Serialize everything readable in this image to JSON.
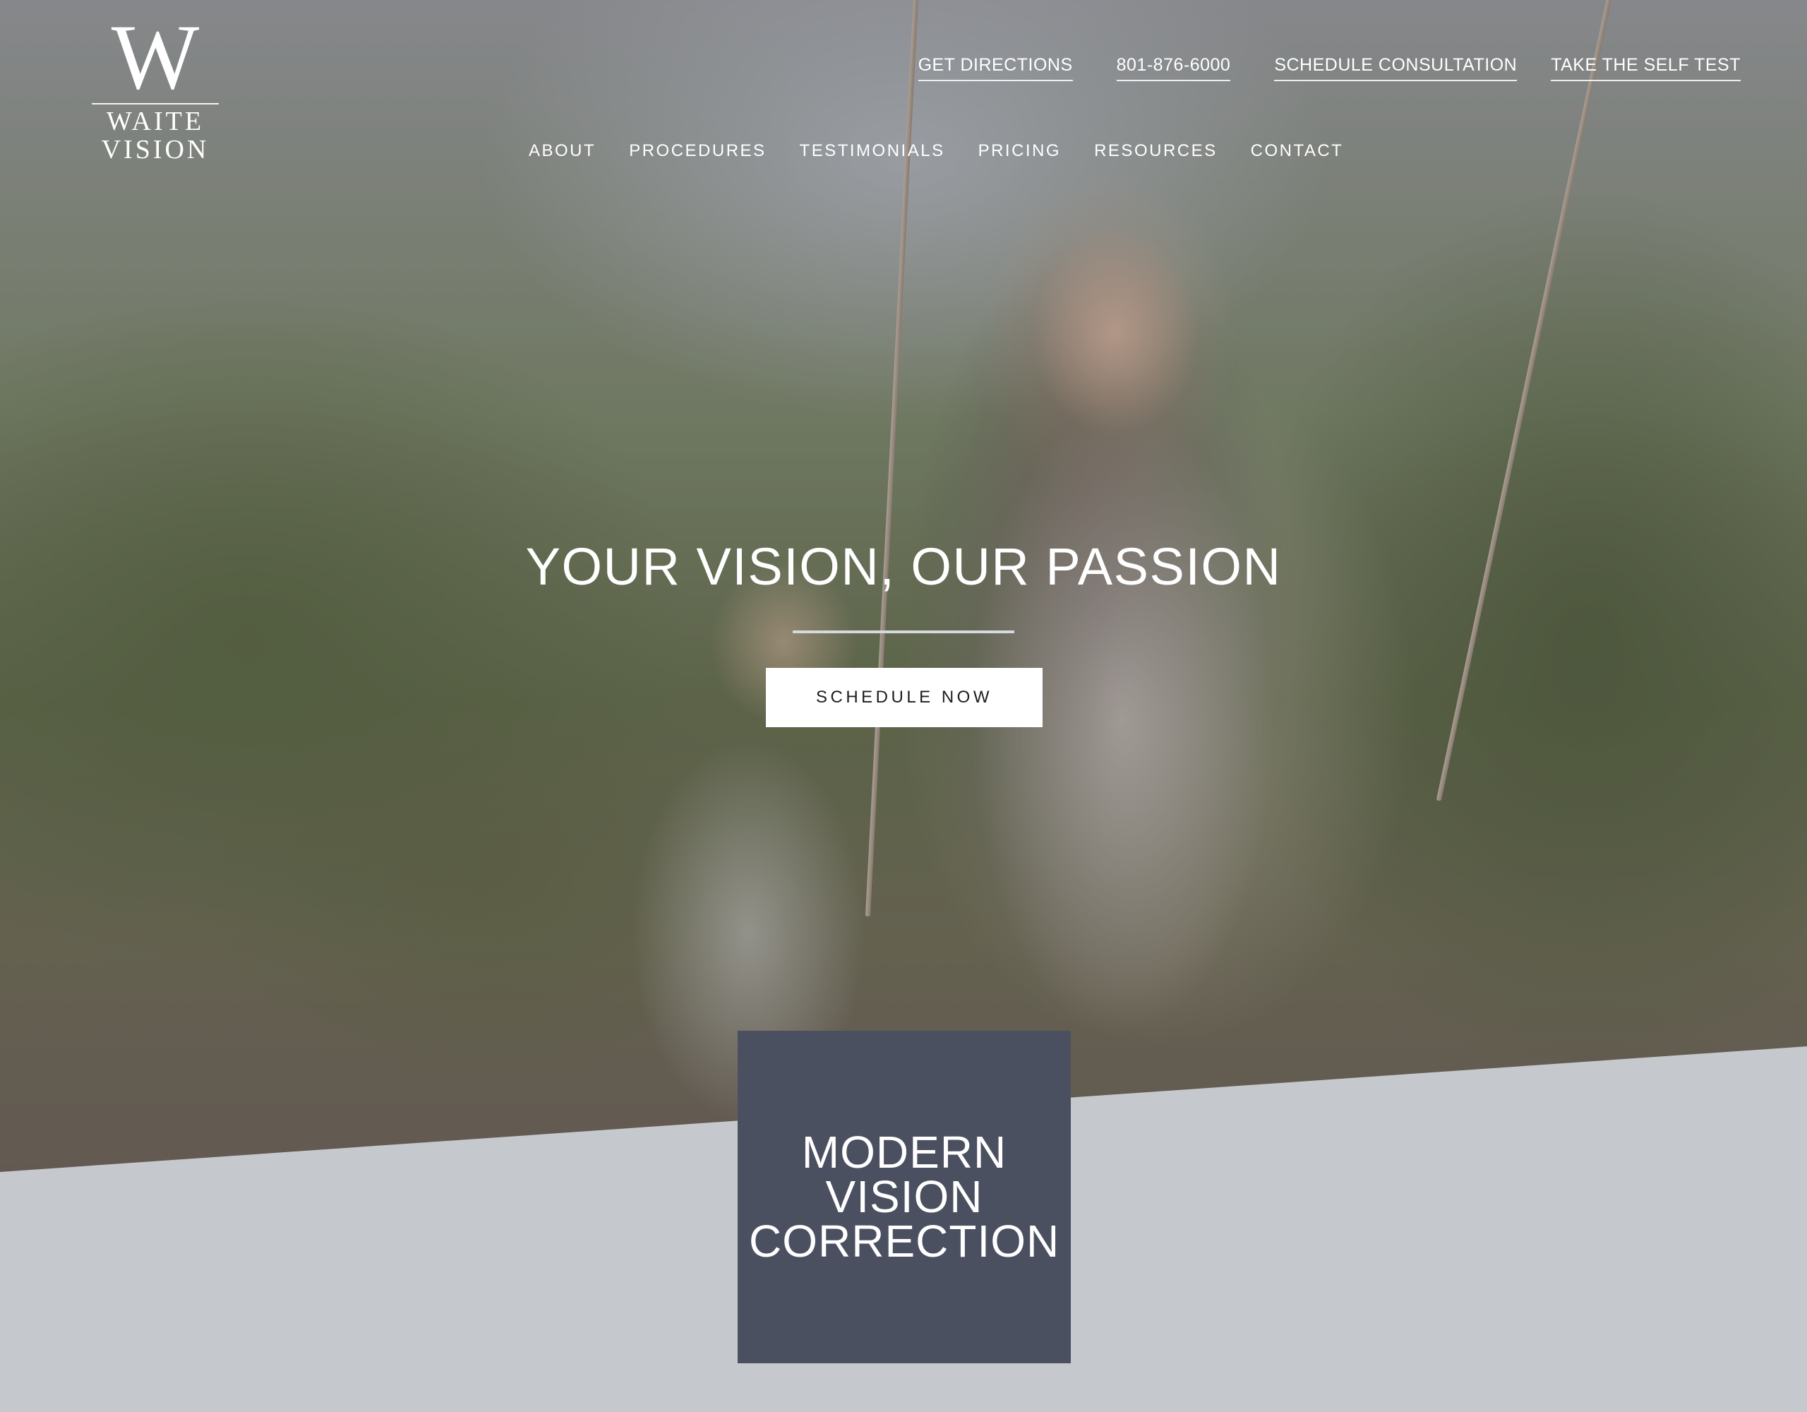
{
  "brand": {
    "logo_mark": "W",
    "logo_text": "WAITE VISION"
  },
  "top_links": [
    {
      "label": "GET DIRECTIONS"
    },
    {
      "label": "801-876-6000"
    },
    {
      "label": "SCHEDULE CONSULTATION"
    },
    {
      "label": "TAKE THE SELF TEST"
    }
  ],
  "main_nav": [
    {
      "label": "ABOUT"
    },
    {
      "label": "PROCEDURES"
    },
    {
      "label": "TESTIMONIALS"
    },
    {
      "label": "PRICING"
    },
    {
      "label": "RESOURCES"
    },
    {
      "label": "CONTACT"
    }
  ],
  "hero": {
    "title": "YOUR VISION, OUR PASSION",
    "cta_label": "SCHEDULE NOW"
  },
  "feature": {
    "heading": "MODERN VISION CORRECTION"
  },
  "colors": {
    "feature_box": "#4b5061",
    "page_background": "#c5c9cd",
    "cta_background": "#ffffff"
  }
}
